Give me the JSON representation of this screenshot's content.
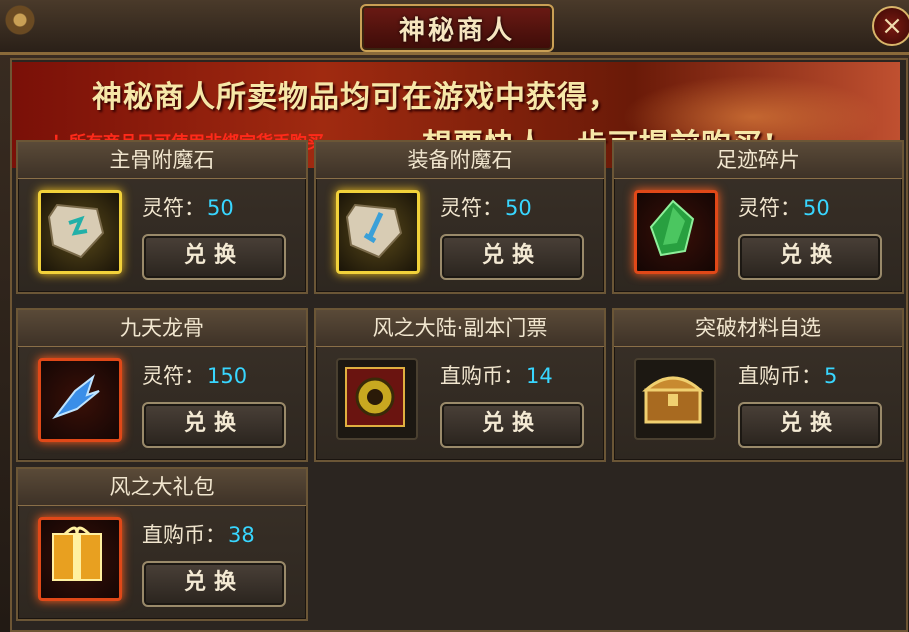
{
  "window": {
    "title": "神秘商人",
    "close_label": "×"
  },
  "banner": {
    "line1": "神秘商人所卖物品均可在游戏中获得，",
    "line2": "想要快人一步可提前购买!",
    "notice": "！所有商品只可使用非绑定货币购买"
  },
  "items": [
    {
      "name": "主骨附魔石",
      "currency": "灵符：",
      "price": "50",
      "button": "兑换",
      "icon": "rune-stone-icon",
      "frame": "yellow"
    },
    {
      "name": "装备附魔石",
      "currency": "灵符：",
      "price": "50",
      "button": "兑换",
      "icon": "sword-rune-icon",
      "frame": "yellow"
    },
    {
      "name": "足迹碎片",
      "currency": "灵符：",
      "price": "50",
      "button": "兑换",
      "icon": "green-crystal-icon",
      "frame": "red"
    },
    {
      "name": "九天龙骨",
      "currency": "灵符：",
      "price": "150",
      "button": "兑换",
      "icon": "dragon-bone-icon",
      "frame": "red"
    },
    {
      "name": "风之大陆·副本门票",
      "currency": "直购币：",
      "price": "14",
      "button": "兑换",
      "icon": "dungeon-ticket-icon",
      "frame": "plain"
    },
    {
      "name": "突破材料自选",
      "currency": "直购币：",
      "price": "5",
      "button": "兑换",
      "icon": "treasure-chest-icon",
      "frame": "plain"
    },
    {
      "name": "风之大礼包",
      "currency": "直购币：",
      "price": "38",
      "button": "兑换",
      "icon": "gift-pack-icon",
      "frame": "red"
    }
  ],
  "colors": {
    "price": "#38d6ff",
    "notice": "#ff2a1a",
    "banner_text": "#f6e7a8"
  }
}
